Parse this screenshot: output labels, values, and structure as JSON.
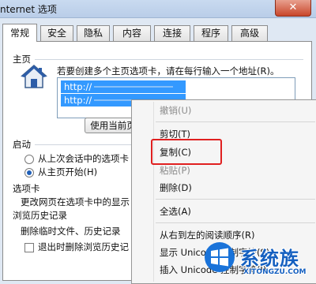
{
  "window": {
    "title": "nternet 选项",
    "close_label": "✕"
  },
  "tabs": [
    "常规",
    "安全",
    "隐私",
    "内容",
    "连接",
    "程序",
    "高级"
  ],
  "home": {
    "group_label": "主页",
    "instruction": "若要创建多个主页选项卡，请在每行输入一个地址(R)。",
    "urls": [
      "http://",
      "http://"
    ],
    "use_current_button": "使用当前页"
  },
  "startup": {
    "group_label": "启动",
    "option_last_session": "从上次会话中的选项卡",
    "option_home": "从主页开始(H)",
    "selected": "option_home"
  },
  "tabs_section": {
    "group_label": "选项卡",
    "description": "更改网页在选项卡中的显示"
  },
  "history": {
    "group_label": "浏览历史记录",
    "description": "删除临时文件、历史记录",
    "delete_on_exit": "退出时删除浏览历史记"
  },
  "context_menu": {
    "items": [
      {
        "label": "撤销(U)",
        "disabled": true
      },
      {
        "label": "剪切(T)",
        "disabled": false
      },
      {
        "label": "复制(C)",
        "disabled": false,
        "highlighted": true
      },
      {
        "label": "粘贴(P)",
        "disabled": true
      },
      {
        "label": "删除(D)",
        "disabled": false
      },
      {
        "label": "全选(A)",
        "disabled": false
      },
      {
        "label": "从右到左的阅读顺序(R)",
        "disabled": false
      },
      {
        "label": "显示 Unicode 控制字符(S)",
        "disabled": false
      },
      {
        "label": "插入 Unicode 控制字符(I)",
        "disabled": false
      }
    ]
  },
  "watermark": {
    "text": "系统族",
    "url": "XITONGZU.COM"
  },
  "colors": {
    "accent": "#3399ff",
    "highlight_box": "#e02020",
    "watermark": "#1560c0"
  }
}
